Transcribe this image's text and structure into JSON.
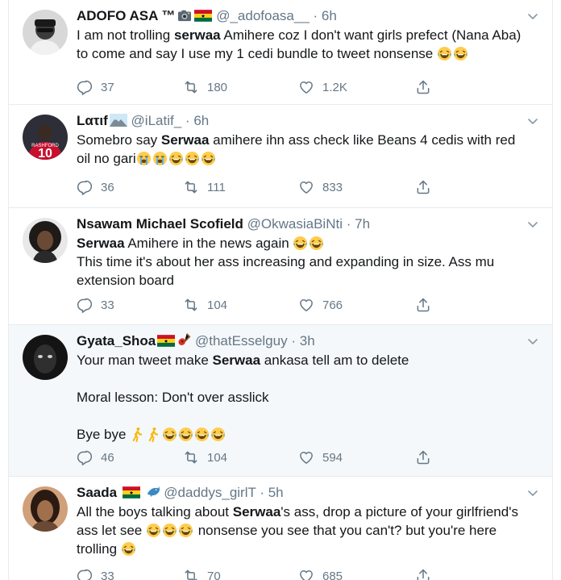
{
  "tweets": [
    {
      "name": "ADOFO ASA ™",
      "handle": "@_adofoasa__",
      "sep": "·",
      "time": "6h",
      "text": [
        "I am not trolling ",
        "serwaa",
        " Amihere coz I don't want girls prefect (Nana Aba) to come and say I use my 1 cedi bundle to tweet nonsense "
      ],
      "replies": "37",
      "retweets": "180",
      "likes": "1.2K"
    },
    {
      "name": "Lατιf",
      "handle": "@iLatif_",
      "sep": "·",
      "time": "6h",
      "text": [
        "Somebro say ",
        "Serwaa",
        " amihere ihn ass check like Beans 4 cedis with red oil no gari"
      ],
      "replies": "36",
      "retweets": "111",
      "likes": "833"
    },
    {
      "name": "Nsawam Michael Scofield",
      "handle": "@OkwasiaBiNti",
      "sep": "·",
      "time": "7h",
      "text1": [
        "Serwaa",
        " Amihere in the news again "
      ],
      "text2": "This time it's about her ass increasing and expanding in size. Ass mu extension board",
      "replies": "33",
      "retweets": "104",
      "likes": "766"
    },
    {
      "name": "Gyata_Shoa",
      "handle": "@thatEsselguy",
      "sep": "·",
      "time": "3h",
      "text1": [
        "Your man tweet make ",
        "Serwaa",
        " ankasa tell am to delete"
      ],
      "text2": "Moral lesson: Don't over asslick",
      "text3": "Bye bye ",
      "replies": "46",
      "retweets": "104",
      "likes": "594"
    },
    {
      "name": "Saada",
      "handle": "@daddys_girlT",
      "sep": "·",
      "time": "5h",
      "text": [
        "All the boys talking about ",
        "Serwaa",
        "'s ass, drop a picture of your girlfriend's ass let see ",
        " nonsense you see that you can't? but you're here trolling "
      ],
      "replies": "33",
      "retweets": "70",
      "likes": "685"
    }
  ],
  "colors": {
    "text": "#14171a",
    "secondary": "#657786",
    "divider": "#e6ecf0",
    "highlight_bg": "#f5f8fa"
  },
  "icons": [
    "reply-icon",
    "retweet-icon",
    "like-icon",
    "share-icon",
    "caret-down-icon",
    "ghana-flag-icon",
    "camera-icon",
    "mountain-icon",
    "guitar-icon",
    "dolphin-icon",
    "laughing-emoji",
    "crying-emoji",
    "walking-emoji"
  ]
}
